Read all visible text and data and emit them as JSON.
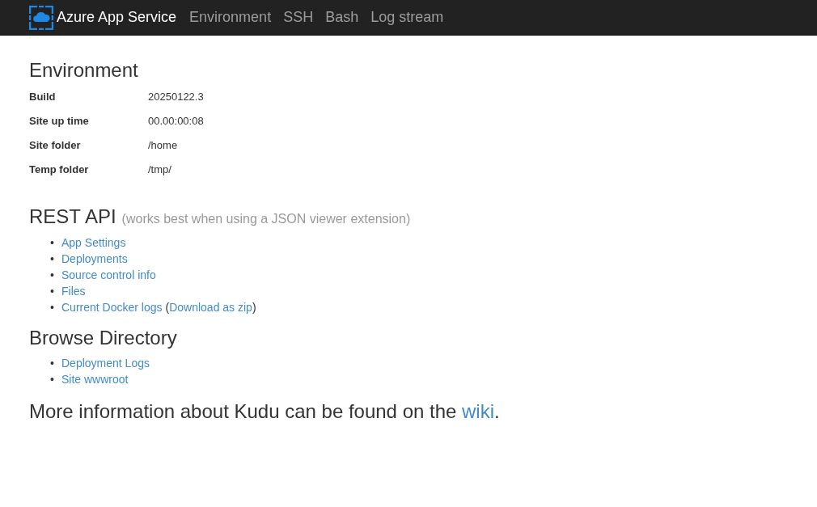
{
  "navbar": {
    "brand": "Azure App Service",
    "links": [
      {
        "label": "Environment"
      },
      {
        "label": "SSH"
      },
      {
        "label": "Bash"
      },
      {
        "label": "Log stream"
      }
    ]
  },
  "environment": {
    "title": "Environment",
    "rows": [
      {
        "label": "Build",
        "value": "20250122.3"
      },
      {
        "label": "Site up time",
        "value": "00.00:00:08"
      },
      {
        "label": "Site folder",
        "value": "/home"
      },
      {
        "label": "Temp folder",
        "value": "/tmp/"
      }
    ]
  },
  "rest_api": {
    "title": "REST API",
    "note": "(works best when using a JSON viewer extension)",
    "links": [
      {
        "bullet": "•",
        "label": "App Settings"
      },
      {
        "bullet": "•",
        "label": "Deployments"
      },
      {
        "bullet": "•",
        "label": "Source control info"
      },
      {
        "bullet": "•",
        "label": "Files"
      },
      {
        "bullet": "•",
        "label": "Current Docker logs",
        "extra": {
          "open": "(",
          "label": "Download as zip",
          "close": ")"
        }
      }
    ]
  },
  "browse_directory": {
    "title": "Browse Directory",
    "links": [
      {
        "bullet": "•",
        "label": "Deployment Logs"
      },
      {
        "bullet": "•",
        "label": "Site wwwroot"
      }
    ]
  },
  "footer": {
    "text": "More information about Kudu can be found on the ",
    "link": "wiki",
    "end": "."
  }
}
